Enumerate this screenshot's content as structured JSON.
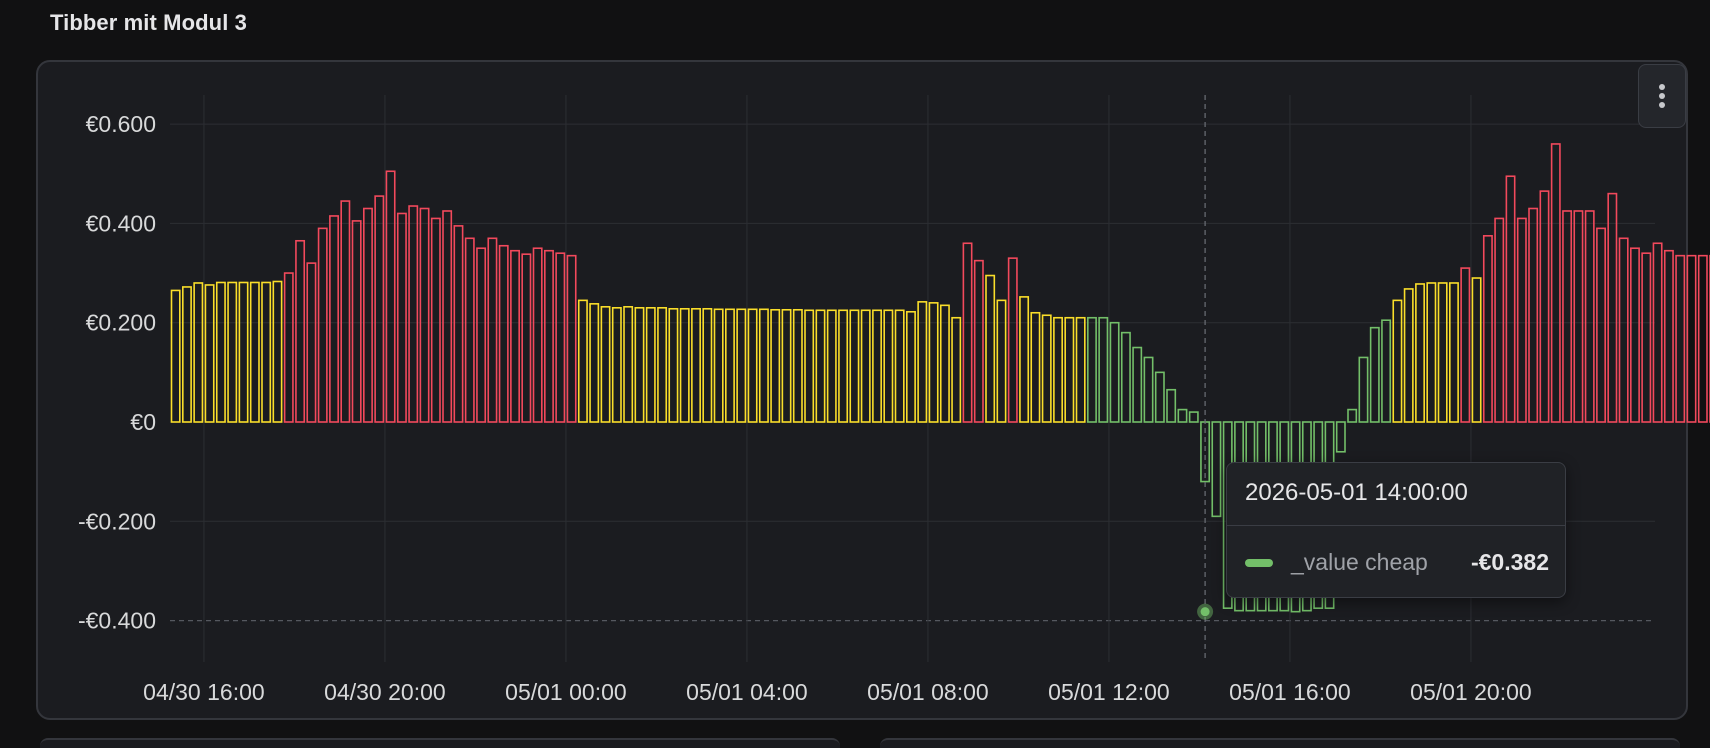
{
  "panel": {
    "title": "Tibber mit Modul 3",
    "menu_icon": "vertical-ellipsis-icon"
  },
  "colors": {
    "cheap": "#73bf69",
    "normal": "#fade2a",
    "expensive": "#f2495c",
    "grid": "#2c2e33",
    "axis_text": "#d8d9da"
  },
  "tooltip": {
    "time": "2026-05-01 14:00:00",
    "series": "_value cheap",
    "value": "-€0.382"
  },
  "chart_data": {
    "type": "bar",
    "interval_minutes": 15,
    "ylim": [
      -0.46,
      0.6
    ],
    "grid": true,
    "y_ticks": [
      {
        "value": 0.6,
        "label": "€0.600"
      },
      {
        "value": 0.4,
        "label": "€0.400"
      },
      {
        "value": 0.2,
        "label": "€0.200"
      },
      {
        "value": 0,
        "label": "€0"
      },
      {
        "value": -0.2,
        "label": "-€0.200"
      },
      {
        "value": -0.4,
        "label": "-€0.400"
      }
    ],
    "x_ticks": [
      {
        "label": "04/30 16:00"
      },
      {
        "label": "04/30 20:00"
      },
      {
        "label": "05/01 00:00"
      },
      {
        "label": "05/01 04:00"
      },
      {
        "label": "05/01 08:00"
      },
      {
        "label": "05/01 12:00"
      },
      {
        "label": "05/01 16:00"
      },
      {
        "label": "05/01 20:00"
      }
    ],
    "x_start": "2026-04-30 15:15",
    "hover_time": "2026-05-01 14:00",
    "hover_value": -0.382,
    "bars": [
      {
        "value": 0.265,
        "level": "normal"
      },
      {
        "value": 0.272,
        "level": "normal"
      },
      {
        "value": 0.28,
        "level": "normal"
      },
      {
        "value": 0.276,
        "level": "normal"
      },
      {
        "value": 0.281,
        "level": "normal"
      },
      {
        "value": 0.281,
        "level": "normal"
      },
      {
        "value": 0.281,
        "level": "normal"
      },
      {
        "value": 0.281,
        "level": "normal"
      },
      {
        "value": 0.281,
        "level": "normal"
      },
      {
        "value": 0.283,
        "level": "normal"
      },
      {
        "value": 0.3,
        "level": "expensive"
      },
      {
        "value": 0.365,
        "level": "expensive"
      },
      {
        "value": 0.32,
        "level": "expensive"
      },
      {
        "value": 0.39,
        "level": "expensive"
      },
      {
        "value": 0.415,
        "level": "expensive"
      },
      {
        "value": 0.445,
        "level": "expensive"
      },
      {
        "value": 0.405,
        "level": "expensive"
      },
      {
        "value": 0.43,
        "level": "expensive"
      },
      {
        "value": 0.455,
        "level": "expensive"
      },
      {
        "value": 0.505,
        "level": "expensive"
      },
      {
        "value": 0.42,
        "level": "expensive"
      },
      {
        "value": 0.435,
        "level": "expensive"
      },
      {
        "value": 0.43,
        "level": "expensive"
      },
      {
        "value": 0.41,
        "level": "expensive"
      },
      {
        "value": 0.425,
        "level": "expensive"
      },
      {
        "value": 0.395,
        "level": "expensive"
      },
      {
        "value": 0.37,
        "level": "expensive"
      },
      {
        "value": 0.35,
        "level": "expensive"
      },
      {
        "value": 0.37,
        "level": "expensive"
      },
      {
        "value": 0.355,
        "level": "expensive"
      },
      {
        "value": 0.345,
        "level": "expensive"
      },
      {
        "value": 0.338,
        "level": "expensive"
      },
      {
        "value": 0.35,
        "level": "expensive"
      },
      {
        "value": 0.345,
        "level": "expensive"
      },
      {
        "value": 0.34,
        "level": "expensive"
      },
      {
        "value": 0.335,
        "level": "expensive"
      },
      {
        "value": 0.245,
        "level": "normal"
      },
      {
        "value": 0.238,
        "level": "normal"
      },
      {
        "value": 0.232,
        "level": "normal"
      },
      {
        "value": 0.23,
        "level": "normal"
      },
      {
        "value": 0.232,
        "level": "normal"
      },
      {
        "value": 0.23,
        "level": "normal"
      },
      {
        "value": 0.23,
        "level": "normal"
      },
      {
        "value": 0.23,
        "level": "normal"
      },
      {
        "value": 0.228,
        "level": "normal"
      },
      {
        "value": 0.228,
        "level": "normal"
      },
      {
        "value": 0.228,
        "level": "normal"
      },
      {
        "value": 0.228,
        "level": "normal"
      },
      {
        "value": 0.227,
        "level": "normal"
      },
      {
        "value": 0.227,
        "level": "normal"
      },
      {
        "value": 0.227,
        "level": "normal"
      },
      {
        "value": 0.227,
        "level": "normal"
      },
      {
        "value": 0.227,
        "level": "normal"
      },
      {
        "value": 0.226,
        "level": "normal"
      },
      {
        "value": 0.226,
        "level": "normal"
      },
      {
        "value": 0.226,
        "level": "normal"
      },
      {
        "value": 0.225,
        "level": "normal"
      },
      {
        "value": 0.225,
        "level": "normal"
      },
      {
        "value": 0.225,
        "level": "normal"
      },
      {
        "value": 0.225,
        "level": "normal"
      },
      {
        "value": 0.225,
        "level": "normal"
      },
      {
        "value": 0.225,
        "level": "normal"
      },
      {
        "value": 0.225,
        "level": "normal"
      },
      {
        "value": 0.225,
        "level": "normal"
      },
      {
        "value": 0.225,
        "level": "normal"
      },
      {
        "value": 0.222,
        "level": "normal"
      },
      {
        "value": 0.242,
        "level": "normal"
      },
      {
        "value": 0.24,
        "level": "normal"
      },
      {
        "value": 0.235,
        "level": "normal"
      },
      {
        "value": 0.21,
        "level": "normal"
      },
      {
        "value": 0.36,
        "level": "expensive"
      },
      {
        "value": 0.325,
        "level": "expensive"
      },
      {
        "value": 0.295,
        "level": "normal"
      },
      {
        "value": 0.245,
        "level": "normal"
      },
      {
        "value": 0.33,
        "level": "expensive"
      },
      {
        "value": 0.252,
        "level": "normal"
      },
      {
        "value": 0.22,
        "level": "normal"
      },
      {
        "value": 0.215,
        "level": "normal"
      },
      {
        "value": 0.21,
        "level": "normal"
      },
      {
        "value": 0.21,
        "level": "normal"
      },
      {
        "value": 0.21,
        "level": "normal"
      },
      {
        "value": 0.21,
        "level": "cheap"
      },
      {
        "value": 0.21,
        "level": "cheap"
      },
      {
        "value": 0.2,
        "level": "cheap"
      },
      {
        "value": 0.18,
        "level": "cheap"
      },
      {
        "value": 0.15,
        "level": "cheap"
      },
      {
        "value": 0.13,
        "level": "cheap"
      },
      {
        "value": 0.1,
        "level": "cheap"
      },
      {
        "value": 0.065,
        "level": "cheap"
      },
      {
        "value": 0.025,
        "level": "cheap"
      },
      {
        "value": 0.02,
        "level": "cheap"
      },
      {
        "value": -0.12,
        "level": "cheap"
      },
      {
        "value": -0.19,
        "level": "cheap"
      },
      {
        "value": -0.375,
        "level": "cheap"
      },
      {
        "value": -0.38,
        "level": "cheap"
      },
      {
        "value": -0.38,
        "level": "cheap"
      },
      {
        "value": -0.38,
        "level": "cheap"
      },
      {
        "value": -0.38,
        "level": "cheap"
      },
      {
        "value": -0.38,
        "level": "cheap"
      },
      {
        "value": -0.382,
        "level": "cheap"
      },
      {
        "value": -0.38,
        "level": "cheap"
      },
      {
        "value": -0.375,
        "level": "cheap"
      },
      {
        "value": -0.375,
        "level": "cheap"
      },
      {
        "value": -0.06,
        "level": "cheap"
      },
      {
        "value": 0.025,
        "level": "cheap"
      },
      {
        "value": 0.13,
        "level": "cheap"
      },
      {
        "value": 0.19,
        "level": "cheap"
      },
      {
        "value": 0.205,
        "level": "cheap"
      },
      {
        "value": 0.245,
        "level": "normal"
      },
      {
        "value": 0.268,
        "level": "normal"
      },
      {
        "value": 0.278,
        "level": "normal"
      },
      {
        "value": 0.28,
        "level": "normal"
      },
      {
        "value": 0.28,
        "level": "normal"
      },
      {
        "value": 0.28,
        "level": "normal"
      },
      {
        "value": 0.31,
        "level": "expensive"
      },
      {
        "value": 0.29,
        "level": "normal"
      },
      {
        "value": 0.375,
        "level": "expensive"
      },
      {
        "value": 0.41,
        "level": "expensive"
      },
      {
        "value": 0.495,
        "level": "expensive"
      },
      {
        "value": 0.41,
        "level": "expensive"
      },
      {
        "value": 0.43,
        "level": "expensive"
      },
      {
        "value": 0.465,
        "level": "expensive"
      },
      {
        "value": 0.56,
        "level": "expensive"
      },
      {
        "value": 0.425,
        "level": "expensive"
      },
      {
        "value": 0.425,
        "level": "expensive"
      },
      {
        "value": 0.425,
        "level": "expensive"
      },
      {
        "value": 0.39,
        "level": "expensive"
      },
      {
        "value": 0.46,
        "level": "expensive"
      },
      {
        "value": 0.37,
        "level": "expensive"
      },
      {
        "value": 0.35,
        "level": "expensive"
      },
      {
        "value": 0.34,
        "level": "expensive"
      },
      {
        "value": 0.36,
        "level": "expensive"
      },
      {
        "value": 0.345,
        "level": "expensive"
      },
      {
        "value": 0.335,
        "level": "expensive"
      },
      {
        "value": 0.335,
        "level": "expensive"
      },
      {
        "value": 0.335,
        "level": "expensive"
      },
      {
        "value": 0.335,
        "level": "expensive"
      },
      {
        "value": 0.33,
        "level": "expensive"
      },
      {
        "value": 0.322,
        "level": "expensive"
      },
      {
        "value": 0.315,
        "level": "expensive"
      }
    ]
  }
}
